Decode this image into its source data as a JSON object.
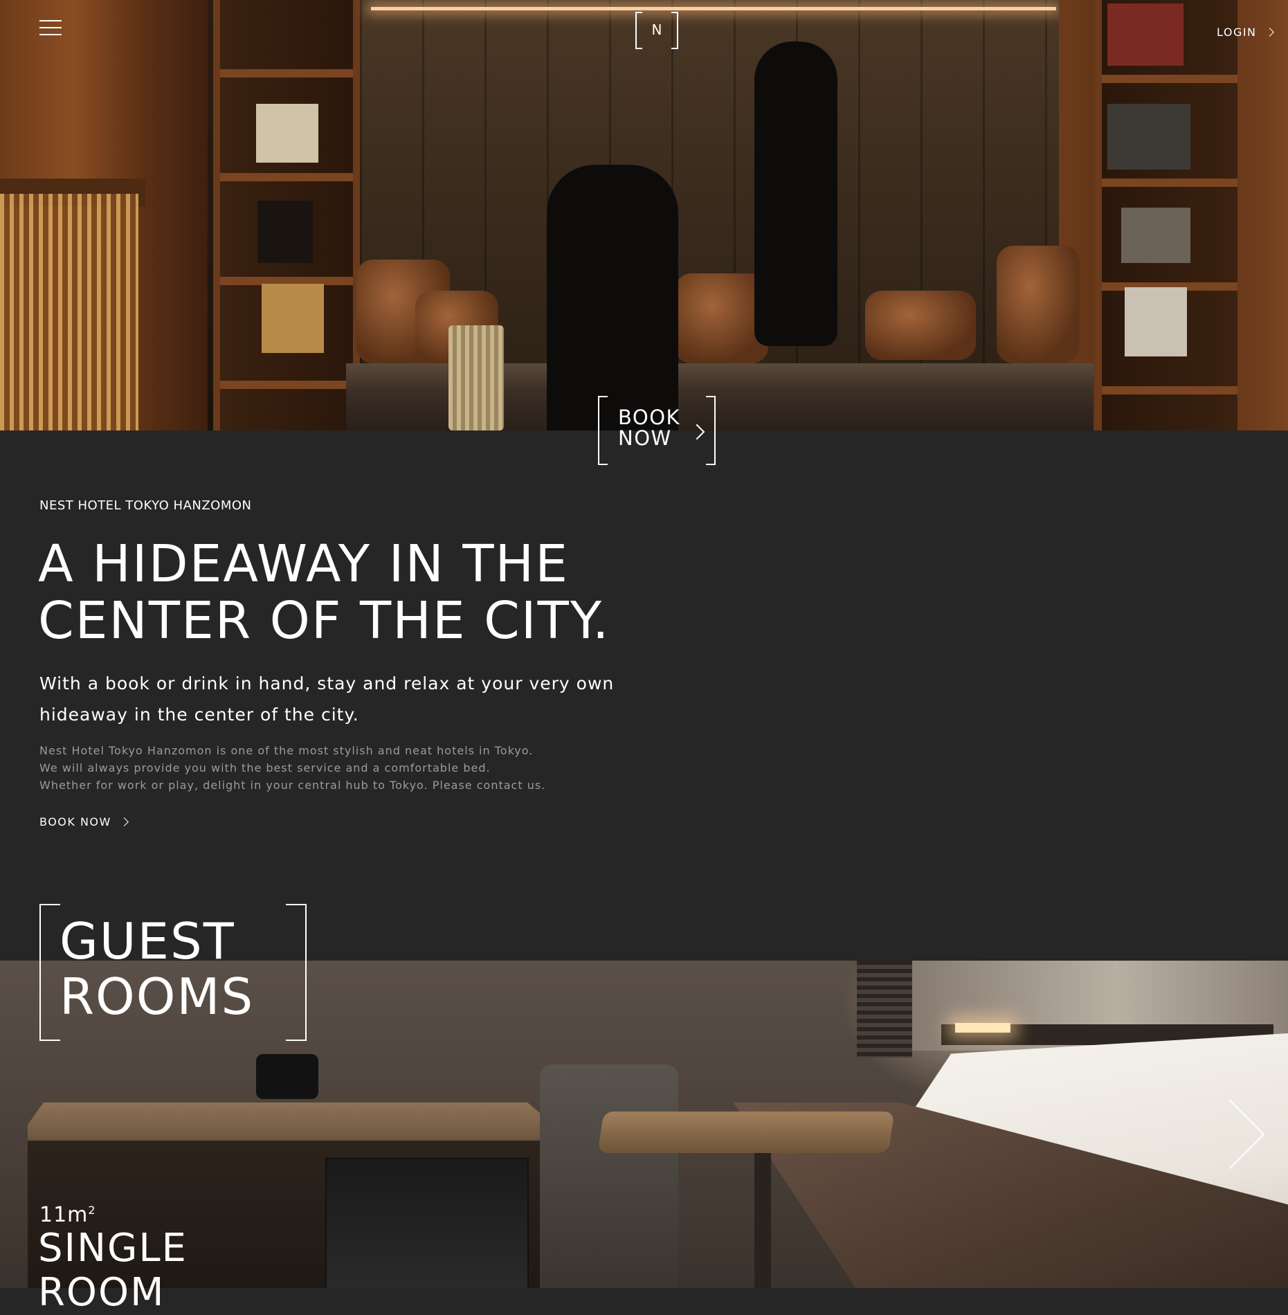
{
  "header": {
    "menu_icon": "hamburger-menu-icon",
    "logo_letter": "N",
    "login_label": "LOGIN"
  },
  "hero": {
    "book_line1": "BOOK",
    "book_line2": "NOW"
  },
  "intro": {
    "eyebrow": "NEST HOTEL TOKYO HANZOMON",
    "headline_line1": "A HIDEAWAY IN THE",
    "headline_line2": "CENTER OF THE CITY.",
    "lead_line1": "With a book or drink in hand, stay and relax at your very own",
    "lead_line2": "hideaway in the center of the city.",
    "body_line1": "Nest Hotel Tokyo Hanzomon is one of the most stylish and neat hotels in Tokyo.",
    "body_line2": "We will always provide you with the best service and a comfortable bed.",
    "body_line3": "Whether for work or play, delight in your central hub to Tokyo. Please contact us.",
    "book_link": "BOOK NOW"
  },
  "rooms": {
    "title_line1": "GUEST",
    "title_line2": "ROOMS",
    "current": {
      "size_value": "11m",
      "size_unit_sup": "2",
      "name_line1": "SINGLE",
      "name_line2": "ROOM"
    },
    "next_icon": "chevron-right-icon"
  },
  "colors": {
    "background": "#262626",
    "text": "#ffffff",
    "muted_text": "#9b9b9b"
  }
}
